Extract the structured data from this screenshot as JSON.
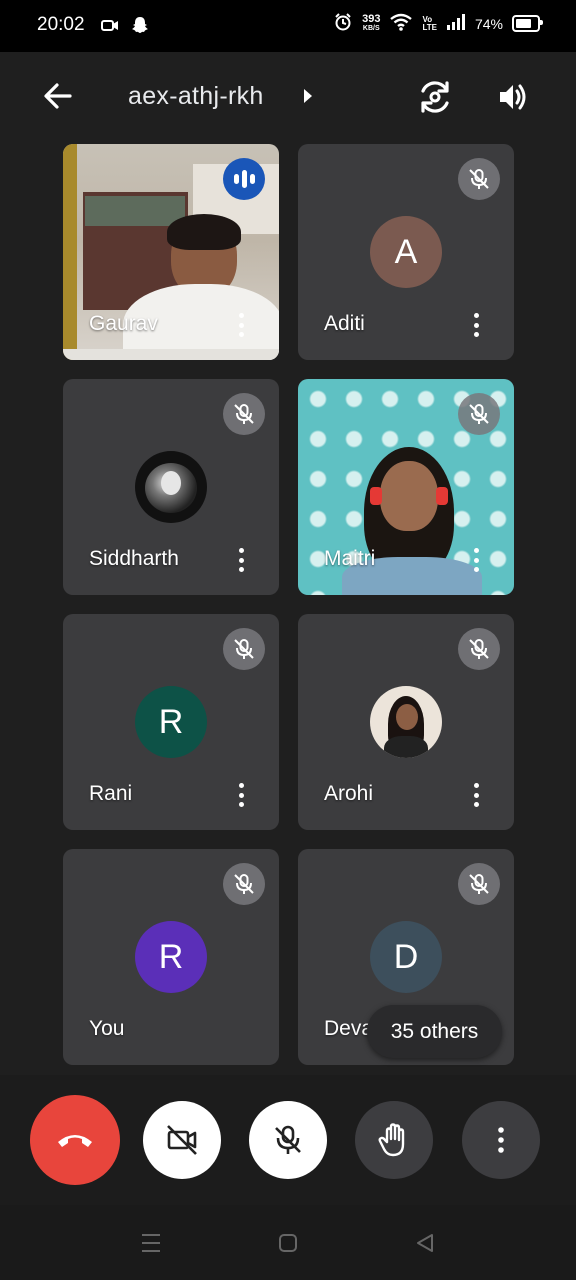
{
  "status_bar": {
    "time": "20:02",
    "net_speed_value": "393",
    "net_speed_unit": "KB/S",
    "volte_top": "Vo",
    "volte_bottom": "LTE",
    "battery": "74%"
  },
  "header": {
    "meeting_code": "aex-athj-rkh"
  },
  "participants": [
    {
      "name": "Gaurav",
      "state": "speaking",
      "video": true
    },
    {
      "name": "Aditi",
      "initial": "A",
      "avatar_color": "#7b5a50",
      "muted": true
    },
    {
      "name": "Siddharth",
      "muted": true,
      "photo_avatar": true
    },
    {
      "name": "Maitri",
      "muted": true,
      "video": true
    },
    {
      "name": "Rani",
      "initial": "R",
      "avatar_color": "#0d5247",
      "muted": true
    },
    {
      "name": "Arohi",
      "muted": true,
      "photo_avatar": true
    },
    {
      "name": "You",
      "initial": "R",
      "avatar_color": "#5b2fb8",
      "muted": true
    },
    {
      "name": "Devanshi",
      "initial": "D",
      "avatar_color": "#3d4f5c",
      "muted": true
    }
  ],
  "others_label": "35 others",
  "colors": {
    "hangup": "#e8453c",
    "speaking": "#1a56b8",
    "background": "#1f1f1f",
    "tile": "#3c3c3e"
  },
  "icons": {
    "back": "arrow-left-icon",
    "switch_camera": "switch-camera-icon",
    "speaker": "speaker-icon",
    "hangup": "phone-hangup-icon",
    "camera_off": "camera-off-icon",
    "mic_off": "mic-off-icon",
    "raise_hand": "hand-icon",
    "more": "more-vert-icon"
  }
}
